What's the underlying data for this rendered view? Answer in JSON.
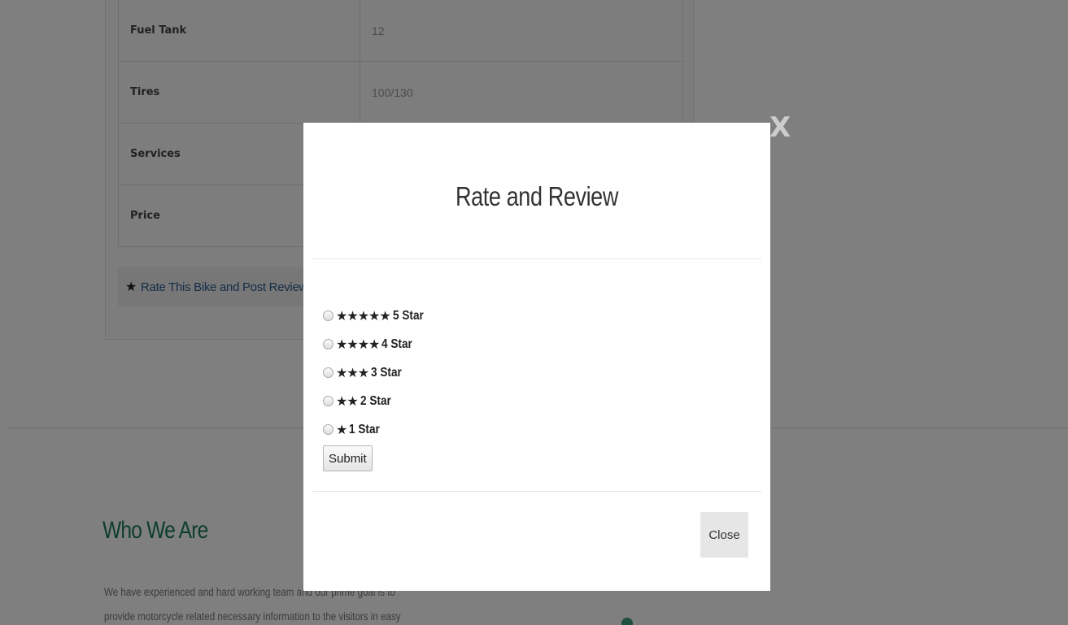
{
  "spec_table": {
    "rows": [
      {
        "label": "Fuel Tank",
        "value": "12"
      },
      {
        "label": "Tires",
        "value": "100/130"
      },
      {
        "label": "Services",
        "value": ""
      },
      {
        "label": "Price",
        "value": ""
      }
    ]
  },
  "rate_link": {
    "star": "★",
    "label": "Rate This Bike and Post Review"
  },
  "who": {
    "title": "Who We Are",
    "line1": "We have experienced and hard working team and our prime goal is to",
    "line2": "provide motorcycle related necessary information to the visitors in easy"
  },
  "overlay": {
    "close_glyph": "X"
  },
  "modal": {
    "title": "Rate and Review",
    "options": [
      {
        "stars": "★★★★★",
        "label": "5 Star"
      },
      {
        "stars": "★★★★",
        "label": "4 Star"
      },
      {
        "stars": "★★★",
        "label": "3 Star"
      },
      {
        "stars": "★★",
        "label": "2 Star"
      },
      {
        "stars": "★",
        "label": "1 Star"
      }
    ],
    "submit_label": "Submit",
    "close_label": "Close"
  }
}
